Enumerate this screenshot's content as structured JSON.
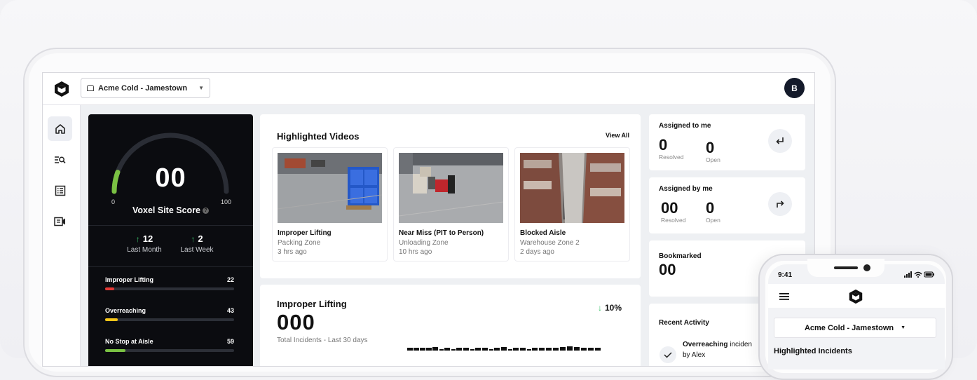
{
  "header": {
    "site_name": "Acme Cold - Jamestown",
    "avatar_initial": "B"
  },
  "colors": {
    "accent_green": "#3cc46b",
    "bar_red": "#e53935",
    "bar_yellow": "#f5c518",
    "bar_green": "#7ac143",
    "panel_dark": "#0b0c10"
  },
  "sidebar": {
    "items": [
      {
        "icon": "home-icon"
      },
      {
        "icon": "search-list-icon"
      },
      {
        "icon": "list-icon"
      },
      {
        "icon": "video-icon"
      }
    ]
  },
  "score": {
    "value": "00",
    "min": "0",
    "max": "100",
    "label": "Voxel Site Score",
    "level": 0.05,
    "last_month_value": "12",
    "last_month_label": "Last Month",
    "last_week_value": "2",
    "last_week_label": "Last Week",
    "categories": [
      {
        "name": "Improper Lifting",
        "value": "22",
        "fill": 0.07,
        "color": "#e53935"
      },
      {
        "name": "Overreaching",
        "value": "43",
        "fill": 0.1,
        "color": "#f5c518"
      },
      {
        "name": "No Stop at Aisle",
        "value": "59",
        "fill": 0.16,
        "color": "#7ac143"
      }
    ]
  },
  "highlighted_videos": {
    "title": "Highlighted Videos",
    "view_all": "View All",
    "items": [
      {
        "title": "Improper Lifting",
        "zone": "Packing Zone",
        "time": "3 hrs ago"
      },
      {
        "title": "Near Miss (PIT to Person)",
        "zone": "Unloading Zone",
        "time": "10 hrs ago"
      },
      {
        "title": "Blocked Aisle",
        "zone": "Warehouse Zone 2",
        "time": "2 days ago"
      }
    ]
  },
  "improper_lifting": {
    "title": "Improper Lifting",
    "change": "10%",
    "total": "000",
    "subtitle": "Total Incidents - Last 30 days"
  },
  "assigned_to_me": {
    "title": "Assigned to me",
    "resolved_value": "0",
    "resolved_label": "Resolved",
    "open_value": "0",
    "open_label": "Open"
  },
  "assigned_by_me": {
    "title": "Assigned by me",
    "resolved_value": "00",
    "resolved_label": "Resolved",
    "open_value": "0",
    "open_label": "Open"
  },
  "bookmarked": {
    "title": "Bookmarked",
    "value": "00"
  },
  "recent_activity": {
    "title": "Recent Activity",
    "item_bold": "Overreaching",
    "item_rest": " inciden",
    "item_by": "by Alex"
  },
  "phone": {
    "time": "9:41",
    "site_name": "Acme Cold - Jamestown",
    "section_title": "Highlighted Incidents"
  }
}
